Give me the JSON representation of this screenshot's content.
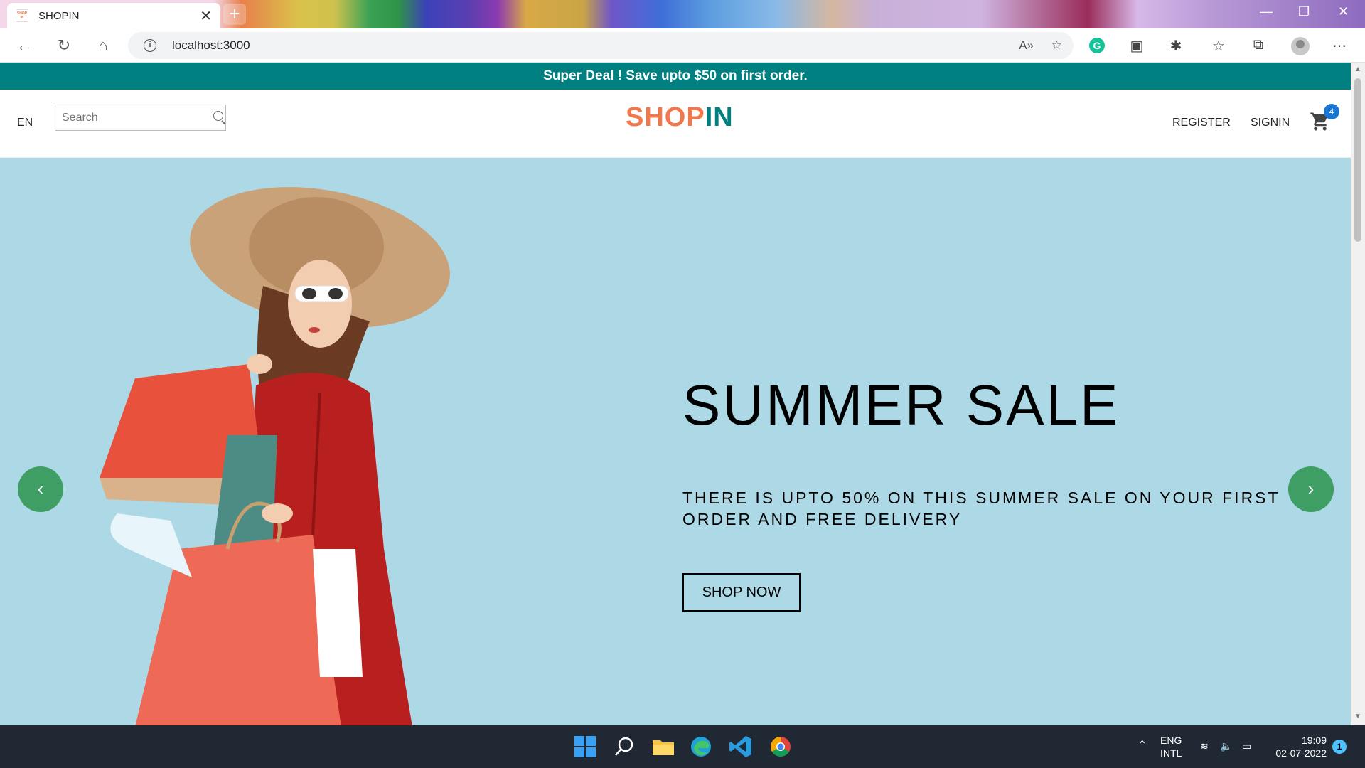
{
  "browser": {
    "tab_title": "SHOPIN",
    "favicon_text": "SHOP IN",
    "url": "localhost:3000",
    "new_tab_symbol": "+",
    "grammarly_letter": "G"
  },
  "announcement": {
    "text": "Super Deal ! Save upto $50 on first order."
  },
  "navbar": {
    "language": "EN",
    "search_placeholder": "Search",
    "logo_part1": "SHOP",
    "logo_part2": "IN",
    "register_label": "REGISTER",
    "signin_label": "SIGNIN",
    "cart_count": "4"
  },
  "hero": {
    "title": "SUMMER SALE",
    "description": "THERE IS UPTO 50% ON THIS SUMMER SALE ON YOUR FIRST ORDER AND FREE DELIVERY",
    "button_label": "SHOP NOW",
    "background_color": "#add8e6",
    "prev_arrow": "‹",
    "next_arrow": "›"
  },
  "taskbar": {
    "language": "ENG",
    "layout": "INTL",
    "time": "19:09",
    "date": "02-07-2022",
    "notification_count": "1"
  },
  "colors": {
    "announcement_bg": "#008080",
    "logo_shop": "#f2784b",
    "logo_in": "#008080",
    "arrow_bg": "#3e9e63",
    "badge_bg": "#1976d2"
  }
}
